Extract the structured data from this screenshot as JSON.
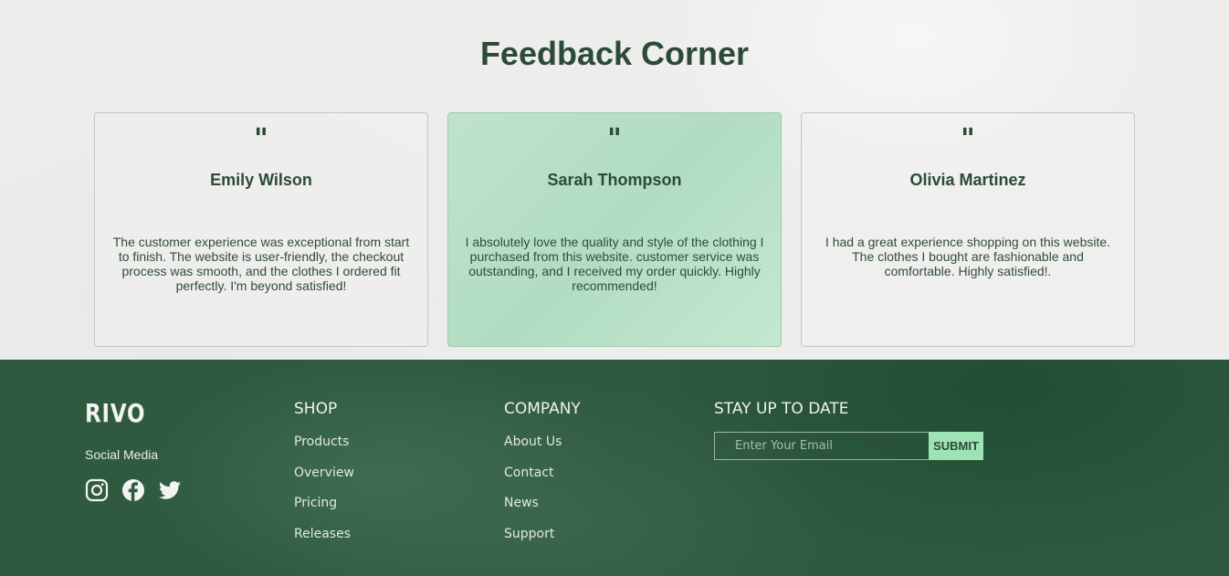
{
  "feedback": {
    "title": "Feedback Corner",
    "quote_mark": "\"",
    "cards": [
      {
        "name": "Emily Wilson",
        "text": "The customer experience was exceptional from start to finish. The website is user-friendly, the checkout process was smooth, and the clothes I ordered fit perfectly. I'm beyond satisfied!"
      },
      {
        "name": "Sarah Thompson",
        "text": "I absolutely love the quality and style of the clothing I purchased from this website. customer service was outstanding, and I received my order quickly. Highly recommended!"
      },
      {
        "name": "Olivia Martinez",
        "text": "I had a great experience shopping on this website. The clothes I bought are fashionable and comfortable. Highly satisfied!."
      }
    ]
  },
  "footer": {
    "logo": "RIVO",
    "social_label": "Social Media",
    "social_icons": [
      "instagram-icon",
      "facebook-icon",
      "twitter-icon"
    ],
    "shop": {
      "heading": "SHOP",
      "links": [
        "Products",
        "Overview",
        "Pricing",
        "Releases"
      ]
    },
    "company": {
      "heading": "COMPANY",
      "links": [
        "About Us",
        "Contact",
        "News",
        "Support"
      ]
    },
    "newsletter": {
      "heading": "STAY UP TO DATE",
      "placeholder": "Enter Your Email",
      "submit_label": "SUBMIT"
    }
  },
  "colors": {
    "dark_green": "#2f5a40",
    "accent_green": "#9ee3b6",
    "text_green": "#2c4a39"
  }
}
